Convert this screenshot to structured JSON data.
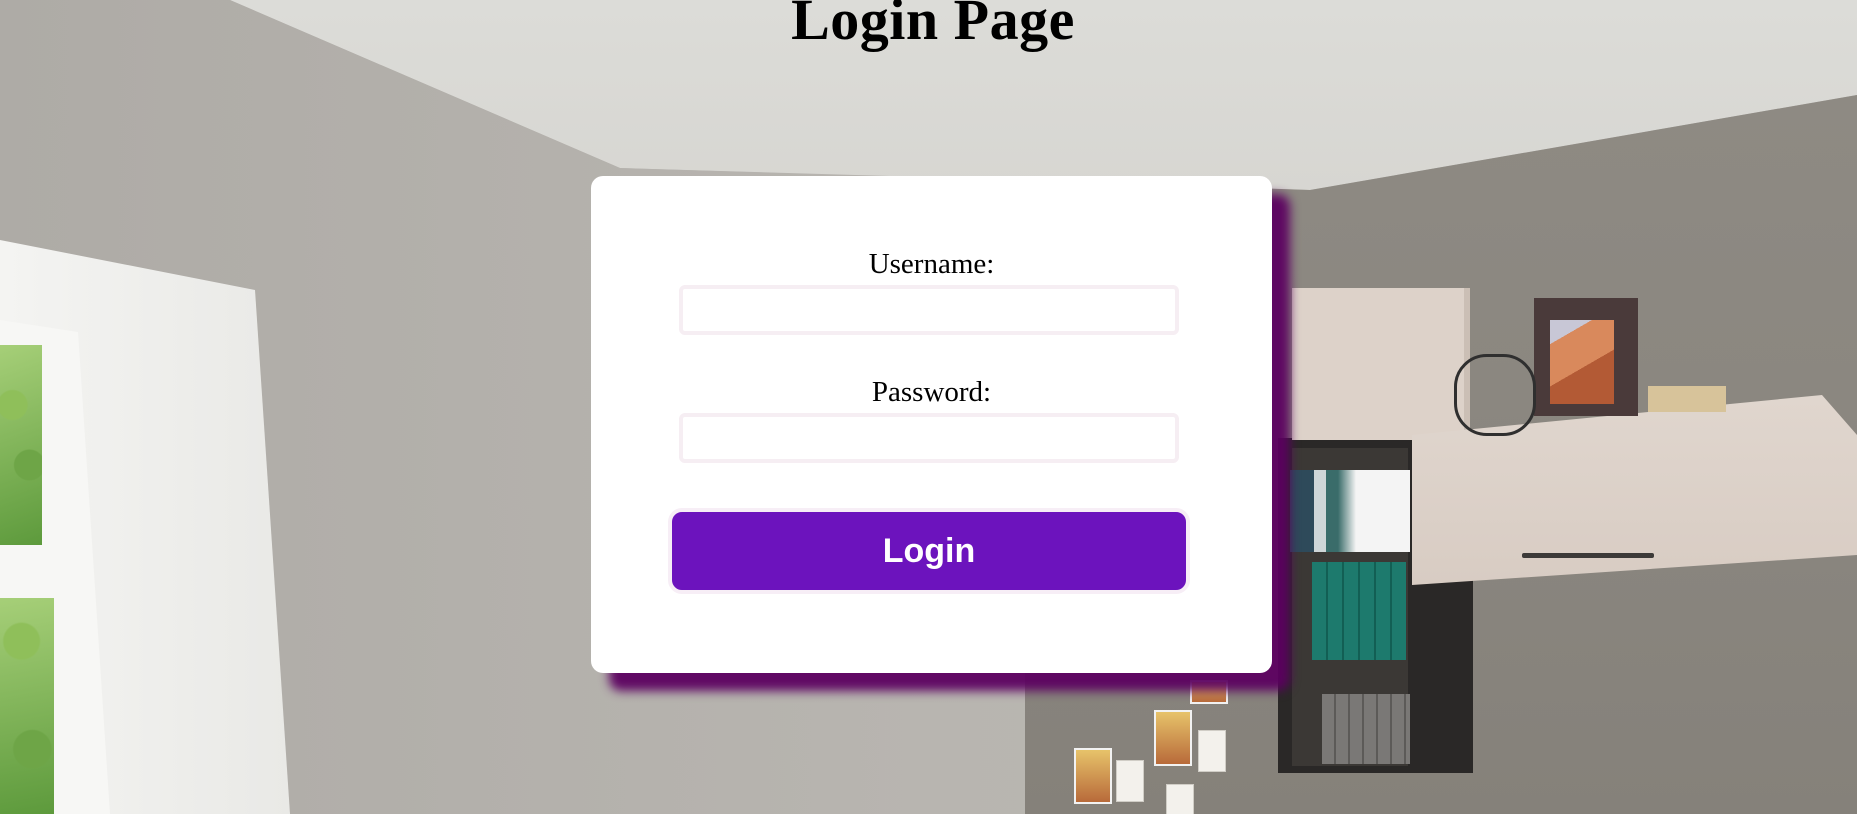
{
  "page": {
    "title": "Login Page"
  },
  "login_form": {
    "username_label": "Username:",
    "username_value": "",
    "password_label": "Password:",
    "password_value": "",
    "submit_label": "Login"
  },
  "colors": {
    "button_bg": "#6c13bd",
    "card_shadow": "#5c0060",
    "card_bg": "#ffffff"
  }
}
